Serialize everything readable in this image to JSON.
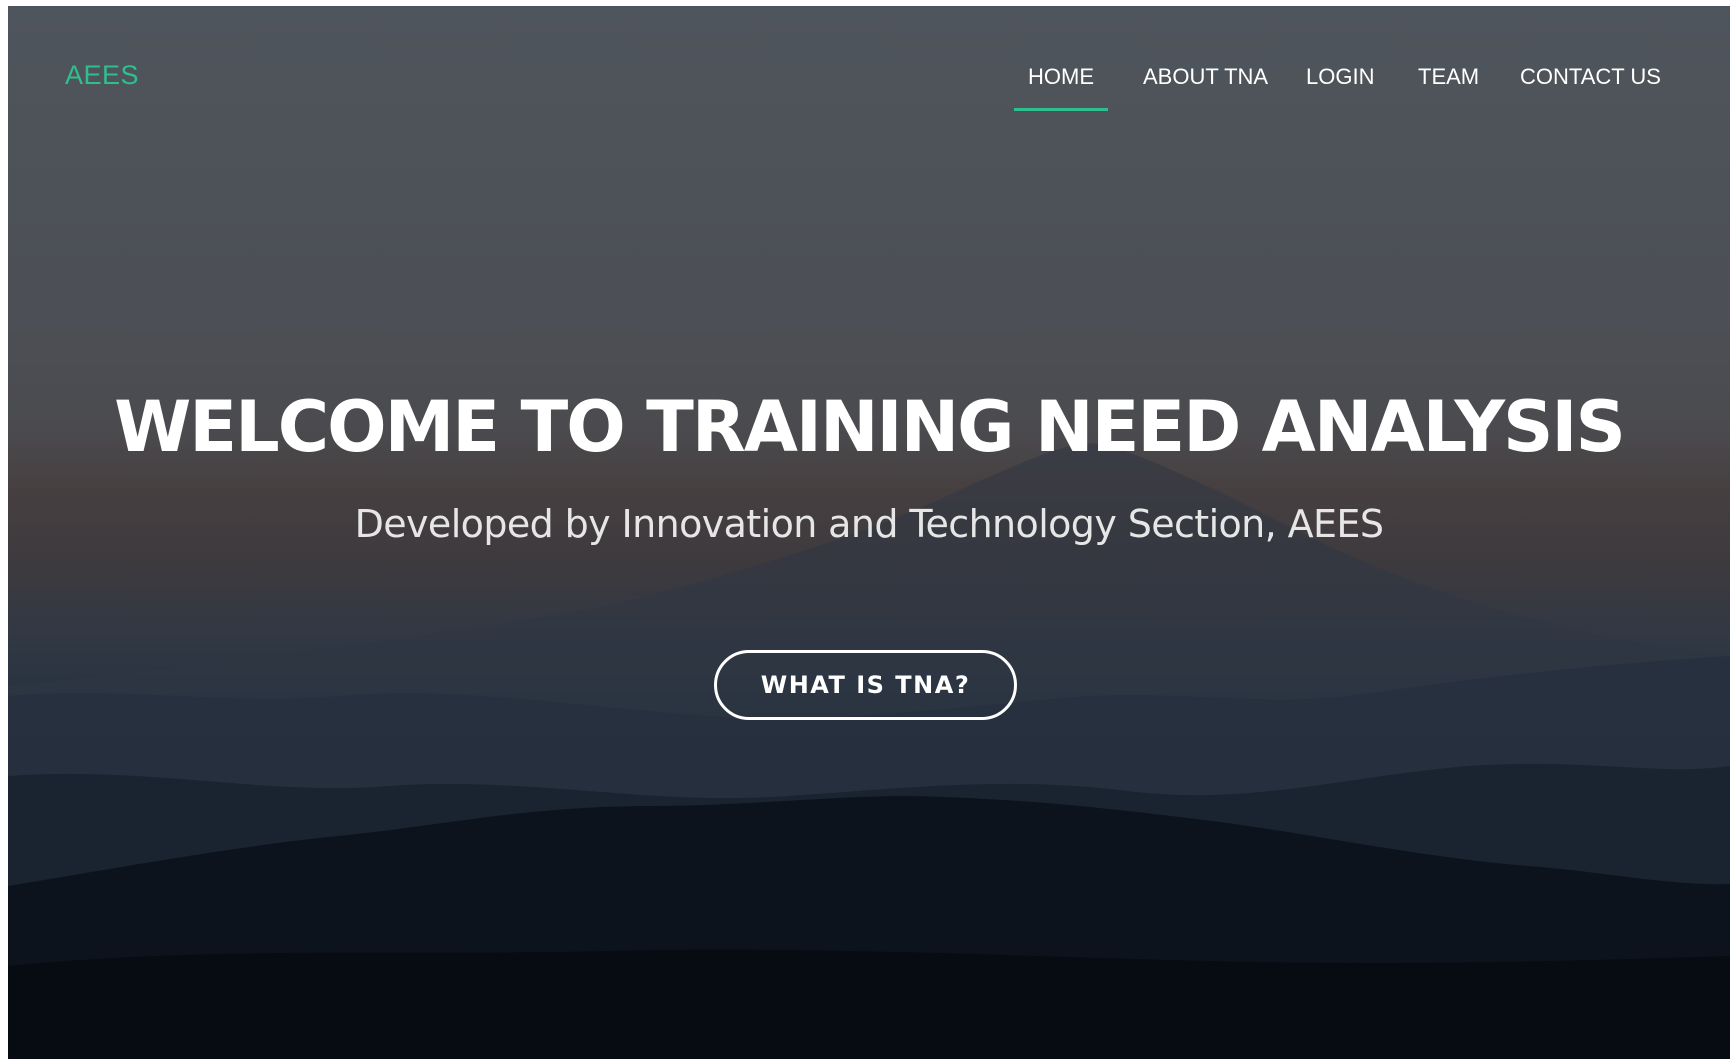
{
  "brand": {
    "name": "AEES",
    "color": "#2fbf8f"
  },
  "nav": {
    "items": [
      {
        "label": "HOME",
        "active": true
      },
      {
        "label": "ABOUT TNA",
        "active": false
      },
      {
        "label": "LOGIN",
        "active": false
      },
      {
        "label": "TEAM",
        "active": false
      },
      {
        "label": "CONTACT US",
        "active": false
      }
    ],
    "active_indicator_color": "#2fbf8f"
  },
  "hero": {
    "title": "WELCOME TO TRAINING NEED ANALYSIS",
    "subtitle": "Developed by Innovation and Technology Section, AEES",
    "cta_label": "WHAT IS TNA?",
    "background": "mountain-landscape-image"
  }
}
